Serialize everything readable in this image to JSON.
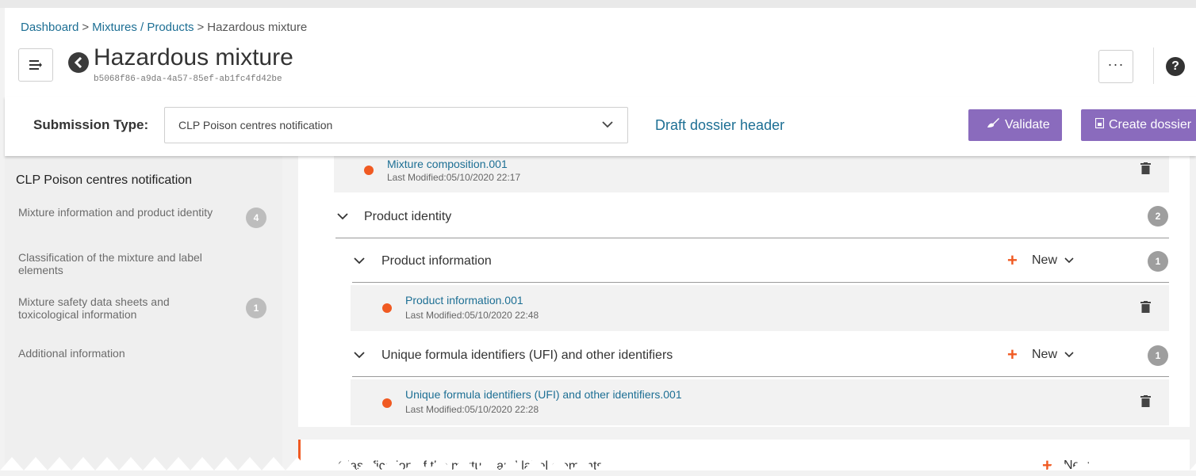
{
  "breadcrumb": {
    "dashboard": "Dashboard",
    "sep1": ">",
    "mixtures": "Mixtures / Products",
    "sep2": ">",
    "current": "Hazardous mixture"
  },
  "header": {
    "title": "Hazardous mixture",
    "uuid": "b5068f86-a9da-4a57-85ef-ab1fc4fd42be",
    "more_label": "···",
    "help_label": "?"
  },
  "submission": {
    "label": "Submission Type:",
    "selected": "CLP Poison centres notification",
    "draft_link": "Draft dossier header",
    "validate_label": "Validate",
    "create_label": "Create dossier"
  },
  "sidebar": {
    "title": "CLP Poison centres notification",
    "items": [
      {
        "label": "Mixture information and product identity",
        "count": "4"
      },
      {
        "label": "Classification of the mixture and label elements"
      },
      {
        "label": "Mixture safety data sheets and toxicological information",
        "count": "1"
      },
      {
        "label": "Additional information"
      }
    ]
  },
  "content": {
    "top_record": {
      "title": "Mixture composition.001",
      "modified": "Last Modified:05/10/2020 22:17"
    },
    "product_identity": {
      "label": "Product identity",
      "count": "2"
    },
    "product_information": {
      "label": "Product information",
      "new_label": "New",
      "count": "1",
      "record": {
        "title": "Product information.001",
        "modified": "Last Modified:05/10/2020 22:48"
      }
    },
    "ufi": {
      "label": "Unique formula identifiers (UFI) and other identifiers",
      "new_label": "New",
      "count": "1",
      "record": {
        "title": "Unique formula identifiers (UFI) and other identifiers.001",
        "modified": "Last Modified:05/10/2020 22:28"
      }
    },
    "bottom_section": {
      "label": "Classification of the mixture and label elements",
      "new_label": "New"
    }
  },
  "colors": {
    "accent_purple": "#8a6bbd",
    "link_blue": "#1d6f94",
    "status_orange": "#f05a22"
  }
}
